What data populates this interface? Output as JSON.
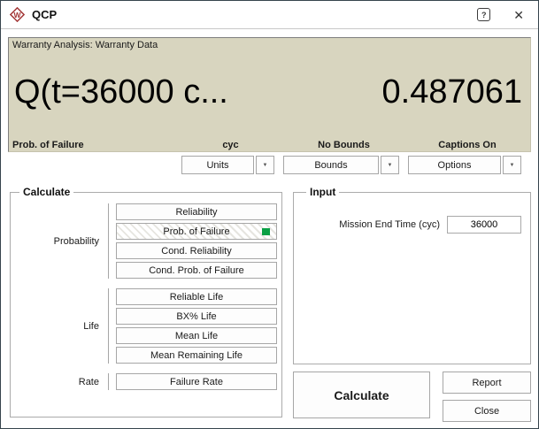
{
  "window": {
    "title": "QCP"
  },
  "titlebar": {
    "help": "?",
    "close": "✕"
  },
  "display": {
    "header": "Warranty Analysis: Warranty Data",
    "expression": "Q(t=36000 c...",
    "result": "0.487061",
    "metric_caption": "Prob. of Failure",
    "units_caption": "cyc",
    "bounds_caption": "No Bounds",
    "options_caption": "Captions On",
    "bg_color": "#d8d5bf"
  },
  "dropdowns": {
    "units": "Units",
    "bounds": "Bounds",
    "options": "Options",
    "arrow": "▼"
  },
  "calculate_group": {
    "title": "Calculate",
    "sections": [
      {
        "label": "Probability",
        "buttons": [
          {
            "label": "Reliability",
            "selected": false
          },
          {
            "label": "Prob. of Failure",
            "selected": true
          },
          {
            "label": "Cond. Reliability",
            "selected": false
          },
          {
            "label": "Cond. Prob. of Failure",
            "selected": false
          }
        ]
      },
      {
        "label": "Life",
        "buttons": [
          {
            "label": "Reliable Life",
            "selected": false
          },
          {
            "label": "BX% Life",
            "selected": false
          },
          {
            "label": "Mean Life",
            "selected": false
          },
          {
            "label": "Mean Remaining Life",
            "selected": false
          }
        ]
      },
      {
        "label": "Rate",
        "buttons": [
          {
            "label": "Failure Rate",
            "selected": false
          }
        ]
      }
    ],
    "selected_indicator_color": "#0aa045"
  },
  "input_group": {
    "title": "Input",
    "field_label": "Mission End Time (cyc)",
    "field_value": "36000"
  },
  "actions": {
    "calculate": "Calculate",
    "report": "Report",
    "close": "Close"
  }
}
